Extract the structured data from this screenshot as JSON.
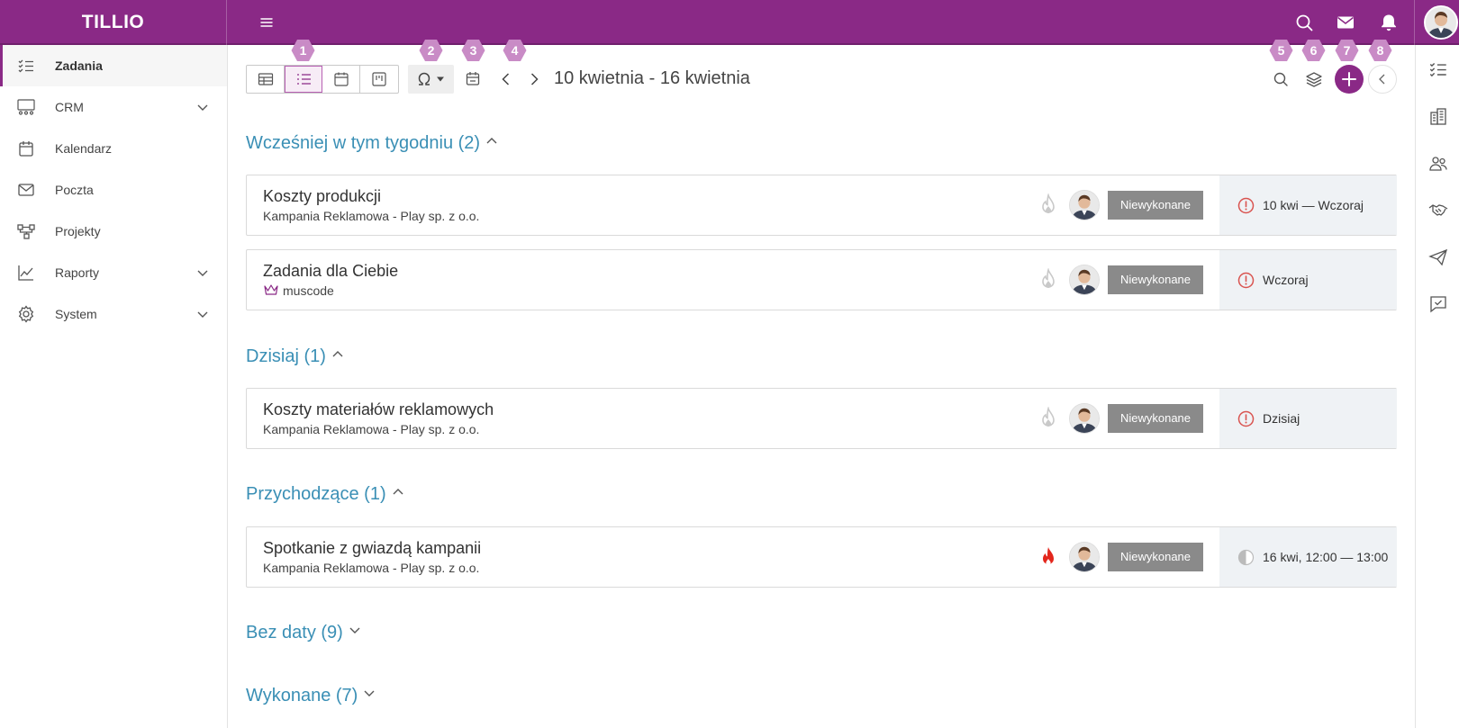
{
  "app": {
    "logo": "TILLIO"
  },
  "sidebar": {
    "items": [
      {
        "label": "Zadania",
        "icon": "tasks-icon",
        "active": true
      },
      {
        "label": "CRM",
        "icon": "crm-icon",
        "expandable": true
      },
      {
        "label": "Kalendarz",
        "icon": "calendar-icon"
      },
      {
        "label": "Poczta",
        "icon": "mail-icon"
      },
      {
        "label": "Projekty",
        "icon": "projects-icon"
      },
      {
        "label": "Raporty",
        "icon": "chart-icon",
        "expandable": true
      },
      {
        "label": "System",
        "icon": "gear-icon",
        "expandable": true
      }
    ]
  },
  "toolbar": {
    "date_range": "10 kwietnia - 16 kwietnia",
    "badges": [
      "1",
      "2",
      "3",
      "4",
      "5",
      "6",
      "7",
      "8"
    ]
  },
  "sections": [
    {
      "title": "Wcześniej w tym tygodniu (2)",
      "expanded": true
    },
    {
      "title": "Dzisiaj (1)",
      "expanded": true
    },
    {
      "title": "Przychodzące (1)",
      "expanded": true
    },
    {
      "title": "Bez daty (9)",
      "expanded": false
    },
    {
      "title": "Wykonane (7)",
      "expanded": false
    }
  ],
  "tasks": [
    {
      "title": "Koszty produkcji",
      "subtitle": "Kampania Reklamowa - Play sp. z o.o.",
      "status": "Niewykonane",
      "due": "10 kwi — Wczoraj",
      "due_icon": "overdue-icon",
      "priority": "normal"
    },
    {
      "title": "Zadania dla Ciebie",
      "subtitle": "muscode",
      "subtitle_icon": "crown-icon",
      "status": "Niewykonane",
      "due": "Wczoraj",
      "due_icon": "overdue-icon",
      "priority": "normal"
    },
    {
      "title": "Koszty materiałów reklamowych",
      "subtitle": "Kampania Reklamowa - Play sp. z o.o.",
      "status": "Niewykonane",
      "due": "Dzisiaj",
      "due_icon": "overdue-icon",
      "priority": "normal"
    },
    {
      "title": "Spotkanie z gwiazdą kampanii",
      "subtitle": "Kampania Reklamowa - Play sp. z o.o.",
      "status": "Niewykonane",
      "due": "16 kwi, 12:00 — 13:00",
      "due_icon": "half-circle-icon",
      "priority": "high"
    }
  ],
  "colors": {
    "brand": "#8a2986",
    "section": "#3a8fb5",
    "status_bg": "#8a8a8a",
    "badge": "#c98bc6",
    "fire_high": "#e3261c",
    "overdue": "#d9534f"
  }
}
